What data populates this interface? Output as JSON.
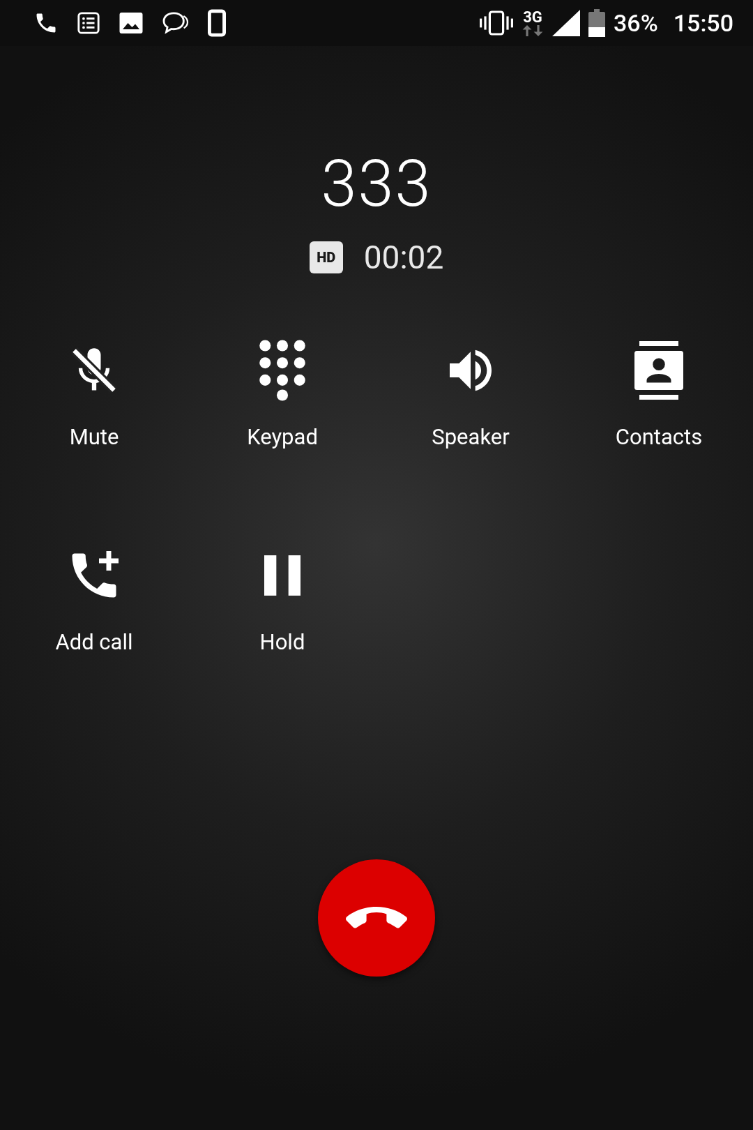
{
  "status_bar": {
    "network": "3G",
    "battery": "36%",
    "time": "15:50"
  },
  "call": {
    "number": "333",
    "badge": "HD",
    "duration": "00:02"
  },
  "controls": [
    {
      "kind": "mute",
      "label": "Mute"
    },
    {
      "kind": "keypad",
      "label": "Keypad"
    },
    {
      "kind": "speaker",
      "label": "Speaker"
    },
    {
      "kind": "contacts",
      "label": "Contacts"
    },
    {
      "kind": "add",
      "label": "Add call"
    },
    {
      "kind": "hold",
      "label": "Hold"
    }
  ],
  "end_call": {
    "kind": "hangup"
  }
}
